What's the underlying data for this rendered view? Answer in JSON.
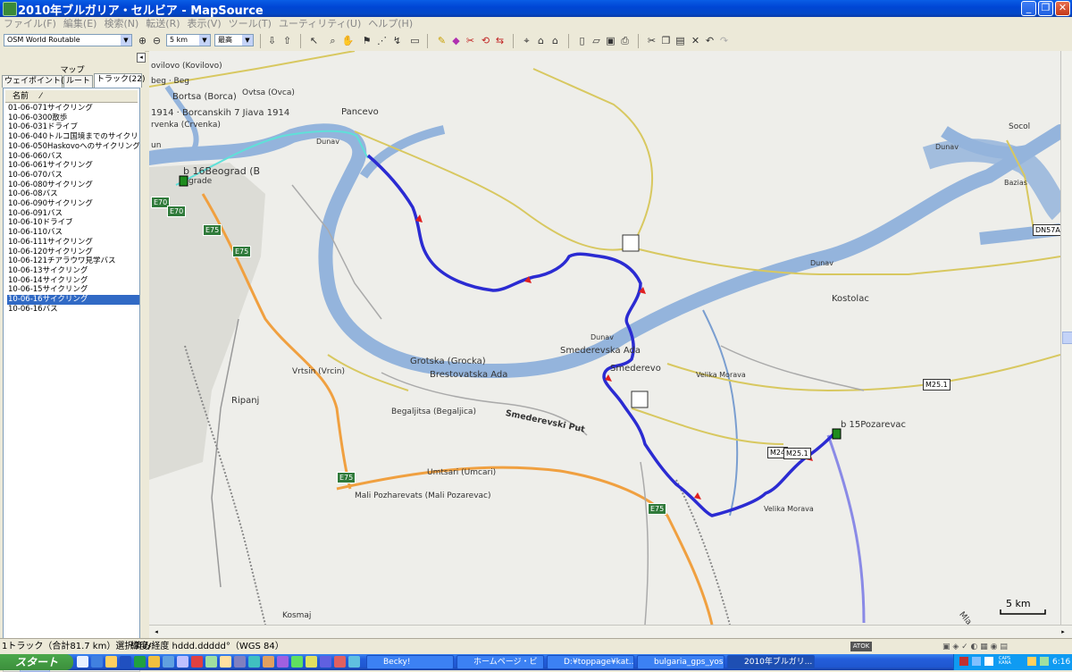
{
  "window": {
    "title": "2010年ブルガリア・セルビア - MapSource"
  },
  "menu": [
    "ファイル(F)",
    "編集(E)",
    "検索(N)",
    "転送(R)",
    "表示(V)",
    "ツール(T)",
    "ユーティリティ(U)",
    "ヘルプ(H)"
  ],
  "toolbar": {
    "map_product": "OSM World Routable",
    "zoom_level": "5 km",
    "detail": "最高"
  },
  "panel": {
    "caption": "マップ",
    "tabs": [
      "ウェイポイント(49)",
      "ルート",
      "トラック(22)"
    ],
    "active_tab": 2,
    "column_header": "名前",
    "tracks": [
      "01-06-071サイクリング",
      "10-06-0300散歩",
      "10-06-031ドライブ",
      "10-06-040トルコ国境までのサイクリング",
      "10-06-050Haskovoへのサイクリング",
      "10-06-060バス",
      "10-06-061サイクリング",
      "10-06-070バス",
      "10-06-080サイクリング",
      "10-06-08バス",
      "10-06-090サイクリング",
      "10-06-091バス",
      "10-06-10ドライブ",
      "10-06-110バス",
      "10-06-111サイクリング",
      "10-06-120サイクリング",
      "10-06-121チアラウワ見学バス",
      "10-06-13サイクリング",
      "10-06-14サイクリング",
      "10-06-15サイクリング",
      "10-06-16サイクリング",
      "10-06-16バス"
    ],
    "selected_index": 20
  },
  "map": {
    "labels": {
      "kovilovo": "ovilovo (Kovilovo)",
      "beg": "beg · Beg",
      "bortsa": "Bortsa (Borca)",
      "ovtsa": "Ovtsa (Ovca)",
      "borcanskih": "1914 · Borcanskih 7 Jiava 1914",
      "pancevo": "Pancevo",
      "crvenka": "rvenka (Crvenka)",
      "dunav1": "Dunav",
      "un": "un",
      "beograd": "b 16Beograd (B",
      "grad": "grade",
      "dunav2": "Dunav",
      "socol": "Socol",
      "bazias": "Bazias",
      "dunav3": "Dunav",
      "kostolac": "Kostolac",
      "dunav4": "Dunav",
      "smederevska": "Smederevska Ada",
      "smederevo": "Smederevo",
      "grotska": "Grotska (Grocka)",
      "brestovatska": "Brestovatska Ada",
      "velika1": "Velika Morava",
      "vrtsin": "Vrtsin (Vrcin)",
      "ripanj": "Ripanj",
      "begaljitsa": "Begaljitsa (Begaljica)",
      "smedput": "Smederevski Put",
      "pozarevac": "b 15Pozarevac",
      "umtsari": "Umtsari (Umcari)",
      "malipoz": "Mali Pozharevats (Mali Pozarevac)",
      "velika2": "Velika Morava",
      "kosmaj": "Kosmaj",
      "mla": "Mla",
      "scale": "5 km"
    },
    "shields": {
      "e70a": "E70",
      "e70b": "E70",
      "e75a": "E75",
      "e75b": "E75",
      "e75c": "E75",
      "e75d": "E75",
      "m251a": "M25.1",
      "m24": "M24",
      "m251b": "M25.1",
      "dn57a": "DN57A"
    }
  },
  "status": {
    "left": "1トラック（合計81.7 km）選択済み",
    "coords": "緯度/経度 hddd.ddddd°（WGS 84）"
  },
  "taskbar": {
    "start": "スタート",
    "tasks": [
      "Becky!",
      "ホームページ・ビ",
      "D:¥toppage¥kat...",
      "bulgaria_gps_yos...",
      "2010年ブルガリ..."
    ],
    "active_task": 4,
    "clock": "6:16"
  },
  "colors": {
    "water": "#94b4dc",
    "track": "#2b2bd2",
    "highway": "#f0a040",
    "road": "#d8c860",
    "selection": "#316ac5",
    "route_cyan": "#5fe0d8"
  }
}
